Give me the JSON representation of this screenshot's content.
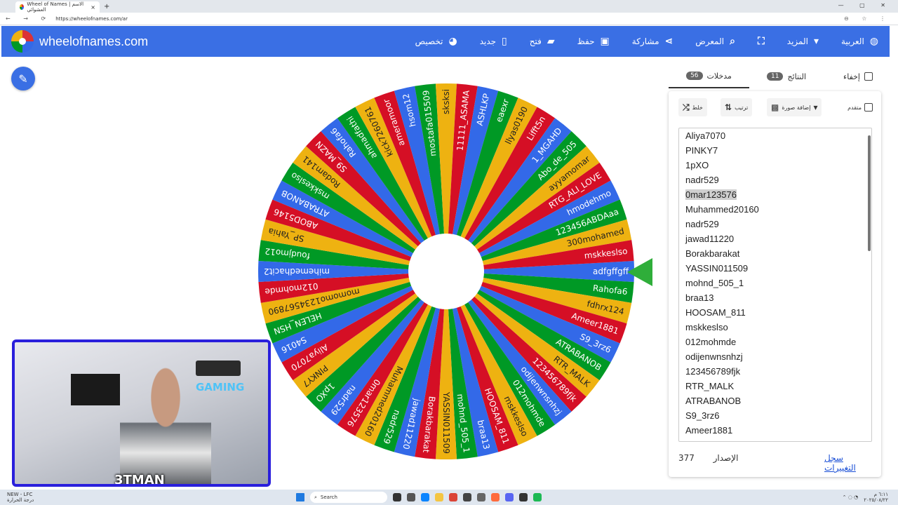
{
  "browser": {
    "tab_title": "Wheel of Names | الاسم العشوائي",
    "url": "https://wheelofnames.com/ar"
  },
  "header": {
    "brand": "wheelofnames.com",
    "menu": [
      {
        "label": "العربية",
        "icon": "globe-icon"
      },
      {
        "label": "المزيد",
        "icon": "caret-down-icon"
      },
      {
        "label": "",
        "icon": "fullscreen-icon"
      },
      {
        "label": "المعرض",
        "icon": "search-icon"
      },
      {
        "label": "مشاركة",
        "icon": "share-icon"
      },
      {
        "label": "حفظ",
        "icon": "save-icon"
      },
      {
        "label": "فتح",
        "icon": "folder-open-icon"
      },
      {
        "label": "جديد",
        "icon": "new-file-icon"
      },
      {
        "label": "تخصيص",
        "icon": "palette-icon"
      }
    ],
    "color": "#3a6fe4"
  },
  "panel": {
    "hide_label": "إخفاء",
    "results_label": "النتائج",
    "results_count": "11",
    "entries_label": "مدخلات",
    "entries_count": "56",
    "advanced_label": "متقدم",
    "add_image_label": "إضافة صورة",
    "sort_label": "ترتيب",
    "shuffle_label": "خلط",
    "entries": [
      "Aliya7070",
      "PINKY7",
      "1pXO",
      "nadr529",
      "0mar123576",
      "Muhammed20160",
      "nadr529",
      "jawad11220",
      "Borakbarakat",
      "YASSIN011509",
      "mohnd_505_1",
      "braa13",
      "HOOSAM_811",
      "mskkeslso",
      "012mohmde",
      "odijenwnsnhzj",
      "123456789fjk",
      "RTR_MALK",
      "ATRABANOB",
      "S9_3rz6",
      "Ameer1881"
    ],
    "highlighted_entry": "0mar123576",
    "version_label": "الإصدار",
    "version_number": "377",
    "changelog_label": "سجل التغييرات"
  },
  "wheel": {
    "colors": [
      "#3369e8",
      "#009925",
      "#eeb211",
      "#d50f25"
    ],
    "slices": [
      "adfgffgff",
      "Rahofa6",
      "fdhrx124",
      "Ameer1881",
      "S9_3rz6",
      "ATRABANOB",
      "RTR_MALK",
      "123456789fjk",
      "odijenwnsnhzj",
      "012mohmde",
      "mskkeslso",
      "HOOSAM_811",
      "braa13",
      "mohnd_505_1",
      "YASSIN011509",
      "Borakbarakat",
      "jawad11220",
      "nadr529",
      "Muhammed20160",
      "0mar123576",
      "nadr529",
      "1pXO",
      "PINKY7",
      "Aliya7070",
      "S4016",
      "HELEN_HSN",
      "momomo1234567890",
      "012mohmde",
      "mihemedhacit2",
      "foudjmo12",
      "SP_Yahia",
      "ABOD5146",
      "ATRABANOB",
      "mskkeslso",
      "Rodam141",
      "S9_MAZN",
      "Rahofa6",
      "ahmadfathi",
      "kick7260761",
      "ameramoor",
      "hsom12",
      "mostafa015509",
      "sksksi",
      "11111_ASAMA",
      "ASHLKP",
      "eaexr",
      "llyas0190",
      "Lifft5n",
      "1_MGAHD",
      "Abo_de_505",
      "ayyamomar",
      "RTG_ALI_LOVE",
      "hmodehmo",
      "123456ABDAaa",
      "300mohamed",
      "mskkeslso"
    ]
  },
  "overlay": {
    "gaming_text": "GAMING",
    "streamer_tag": "3TMAN"
  },
  "taskbar": {
    "weather_line1": "NEW - LFC",
    "weather_line2": "درجة الحرارة",
    "search_label": "Search",
    "time": "٦:١١ م",
    "date": "٢٠٢٥/٠٨/٢٢"
  }
}
